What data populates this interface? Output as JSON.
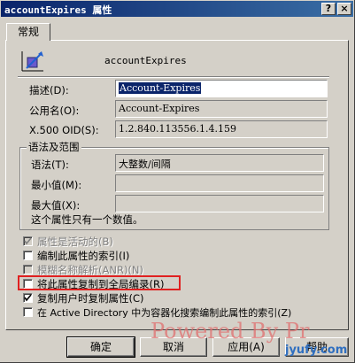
{
  "window": {
    "title": "accountExpires 属性",
    "help_glyph": "?",
    "close_glyph": "×"
  },
  "tabs": [
    {
      "label": "常规"
    }
  ],
  "attribute_name": "accountExpires",
  "fields": {
    "description": {
      "label": "描述(D):",
      "value": "Account-Expires"
    },
    "common_name": {
      "label": "公用名(O):",
      "value": "Account-Expires"
    },
    "oid": {
      "label": "X.500 OID(S):",
      "value": "1.2.840.113556.1.4.159"
    }
  },
  "syntax_group": {
    "title": "语法及范围",
    "syntax": {
      "label": "语法(T):",
      "value": "大整数/间隔"
    },
    "min": {
      "label": "最小值(M):",
      "value": ""
    },
    "max": {
      "label": "最大值(X):",
      "value": ""
    },
    "note": "这个属性只有一个数值。"
  },
  "checkboxes": [
    {
      "label": "属性是活动的(B)",
      "checked": true,
      "disabled": true
    },
    {
      "label": "编制此属性的索引(I)",
      "checked": false,
      "disabled": false
    },
    {
      "label": "模糊名称解析(ANR)(N)",
      "checked": false,
      "disabled": true
    },
    {
      "label": "将此属性复制到全局编录(R)",
      "checked": false,
      "disabled": false
    },
    {
      "label": "复制用户时复制属性(C)",
      "checked": true,
      "disabled": false
    },
    {
      "label": "在 Active Directory 中为容器化搜索编制此属性的索引(Z)",
      "checked": false,
      "disabled": false
    }
  ],
  "buttons": {
    "ok": "确定",
    "cancel": "取消",
    "apply": "应用(A)",
    "help": "帮助"
  },
  "watermark": {
    "text": "Powered By Pr",
    "site": "jyufy.com"
  },
  "colors": {
    "titlebar": "#0a246a",
    "highlight_box": "#e02020",
    "selection": "#0a246a"
  }
}
